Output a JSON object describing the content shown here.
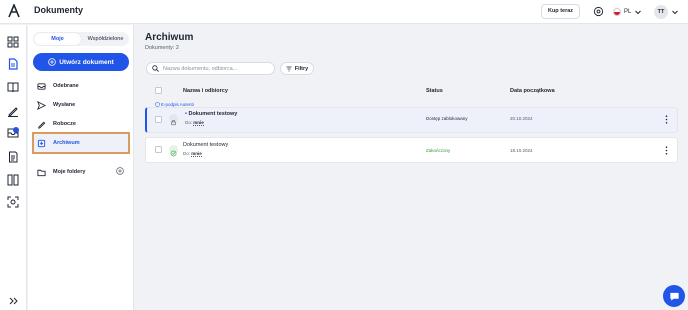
{
  "app": {
    "title": "Dokumenty"
  },
  "header": {
    "buy_label": "Kup teraz",
    "language": "PL",
    "user_initials": "TT"
  },
  "sidebar": {
    "tabs": [
      {
        "label": "Moje"
      },
      {
        "label": "Współdzielone"
      }
    ],
    "create_label": "Utwórz dokument",
    "items": [
      {
        "label": "Odebrane"
      },
      {
        "label": "Wysłane"
      },
      {
        "label": "Robocze"
      },
      {
        "label": "Archiwum"
      },
      {
        "label": "Moje foldery"
      }
    ]
  },
  "main": {
    "title": "Archiwum",
    "doc_count": "Dokumenty: 2",
    "search_placeholder": "Nazwa dokumentu, odbiorca...",
    "filters_label": "Filtry",
    "columns": {
      "name": "Nazwa i odbiorcy",
      "status": "Status",
      "date": "Data początkowa"
    },
    "rows": [
      {
        "tag": "E-podpis Autenti",
        "name": "Dokument testowy",
        "to_prefix": "Do:",
        "to": "mnie",
        "status": "Dostęp zablokowany",
        "date": "20.10.2024",
        "status_color": "#1d2433"
      },
      {
        "name": "Dokument testowy",
        "to_prefix": "Do:",
        "to": "mnie",
        "status": "Zakończony",
        "date": "18.10.2024",
        "status_color": "#2a9d3b"
      }
    ]
  },
  "colors": {
    "accent": "#2155e8",
    "highlight_border": "#d99b5e",
    "success": "#2a9d3b"
  }
}
